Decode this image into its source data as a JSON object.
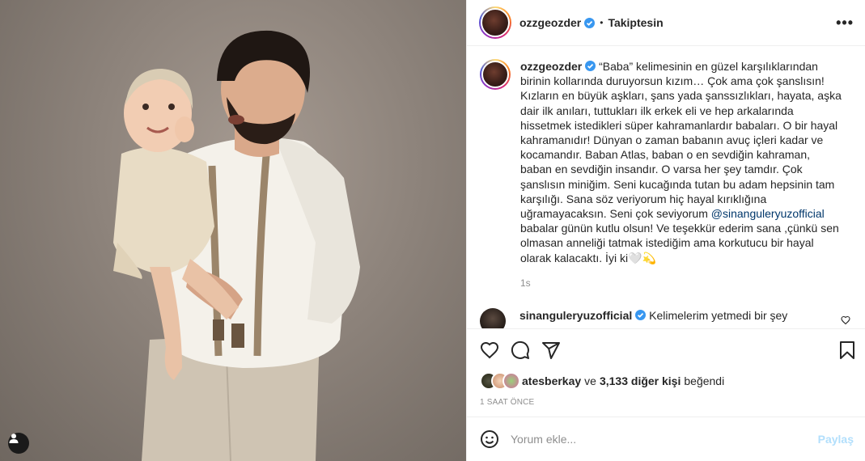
{
  "post": {
    "username": "ozzgeozder",
    "follow_state": "Takiptesin",
    "more_label": "•••",
    "caption_parts": {
      "p1": "“Baba” kelimesinin en güzel karşılıklarından birinin kollarında duruyorsun kızım… Çok ama çok şanslısın! Kızların en büyük aşkları, şans yada şanssızlıkları, hayata, aşka dair ilk anıları, tuttukları ilk erkek eli ve hep arkalarında hissetmek istedikleri süper kahramanlardır babaları. O bir hayal kahramanıdır! Dünyan o zaman babanın avuç içleri kadar ve kocamandır. Baban Atlas, baban o en sevdiğin kahraman, baban en sevdiğin insandır. O varsa her şey tamdır. Çok şanslısın miniğim. Seni kucağında tutan bu adam hepsinin tam karşılığı. Sana söz veriyorum hiç hayal kırıklığına uğramayacaksın. Seni çok seviyorum ",
      "mention": "@sinanguleryuzofficial",
      "p2": " babalar günün kutlu olsun! Ve teşekkür ederim sana ,çünkü sen olmasan anneliği tatmak istediğim ama korkutucu bir hayal olarak kalacaktı. İyi ki",
      "emoji": "🤍💫"
    },
    "caption_time": "1s",
    "comment": {
      "username": "sinanguleryuzofficial",
      "text": "Kelimelerim yetmedi bir şey"
    },
    "likes": {
      "liker": "atesberkay",
      "connector": "ve",
      "others": "3,133 diğer kişi",
      "suffix": "beğendi"
    },
    "posted_ago": "1 SAAT ÖNCE",
    "comment_input": {
      "placeholder": "Yorum ekle...",
      "submit_label": "Paylaş"
    },
    "icons": {
      "like": "heart-icon",
      "comment": "comment-icon",
      "share": "paper-plane-icon",
      "save": "bookmark-icon",
      "emoji": "smiley-icon",
      "tags": "user-tag-icon",
      "verified": "verified-badge-icon"
    },
    "colors": {
      "verified": "#3897f0",
      "link": "#00376b",
      "disabled_post": "#b2dffc"
    }
  }
}
